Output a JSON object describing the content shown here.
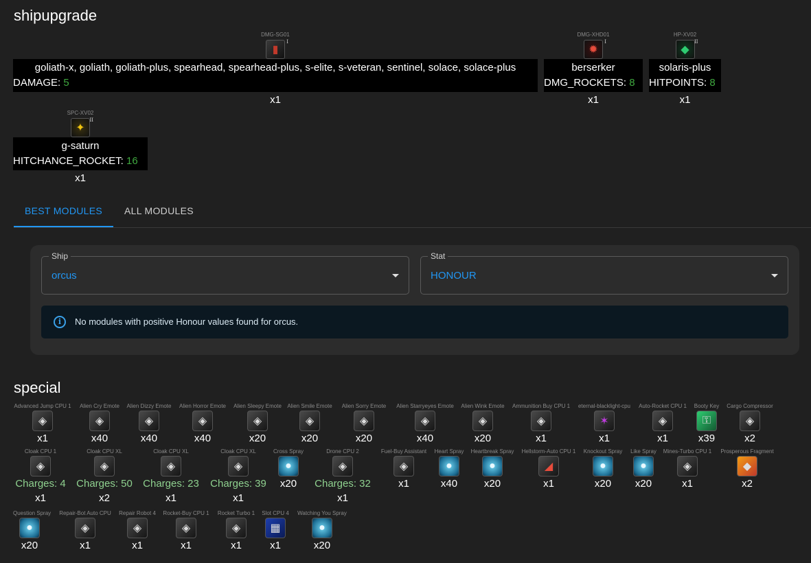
{
  "sections": {
    "shipupgrade_title": "shipupgrade",
    "special_title": "special"
  },
  "upgrades": [
    {
      "code": "DMG-SG01",
      "tier": "I",
      "ships": "goliath-x, goliath, goliath-plus, spearhead, spearhead-plus, s-elite, s-veteran, sentinel, solace, solace-plus",
      "stat": "DAMAGE:",
      "value": "5",
      "qty": "x1",
      "icon": "red-canister-icon"
    },
    {
      "code": "DMG-XHD01",
      "tier": "I",
      "ships": "berserker",
      "stat": "DMG_ROCKETS:",
      "value": "8",
      "qty": "x1",
      "icon": "red-claw-icon"
    },
    {
      "code": "HP-XV02",
      "tier": "II",
      "ships": "solaris-plus",
      "stat": "HITPOINTS:",
      "value": "8",
      "qty": "x1",
      "icon": "green-crystal-icon"
    },
    {
      "code": "SPC-XV02",
      "tier": "II",
      "ships": "g-saturn",
      "stat": "HITCHANCE_ROCKET:",
      "value": "16",
      "qty": "x1",
      "icon": "gold-armor-icon"
    }
  ],
  "tabs": {
    "best": "BEST MODULES",
    "all": "ALL MODULES"
  },
  "filters": {
    "ship_label": "Ship",
    "ship_value": "orcus",
    "stat_label": "Stat",
    "stat_value": "HONOUR",
    "info_message": "No modules with positive Honour values found for orcus."
  },
  "special_items": [
    {
      "name": "Advanced Jump CPU 1",
      "qty": "x1",
      "charges": "",
      "icon": "jump-cpu-icon"
    },
    {
      "name": "Alien Cry Emote",
      "qty": "x40",
      "charges": "",
      "icon": "alien-cry-icon"
    },
    {
      "name": "Alien Dizzy Emote",
      "qty": "x40",
      "charges": "",
      "icon": "alien-dizzy-icon"
    },
    {
      "name": "Alien Horror Emote",
      "qty": "x40",
      "charges": "",
      "icon": "alien-horror-icon"
    },
    {
      "name": "Alien Sleepy Emote",
      "qty": "x20",
      "charges": "",
      "icon": "alien-sleepy-icon"
    },
    {
      "name": "Alien Smile Emote",
      "qty": "x20",
      "charges": "",
      "icon": "alien-smile-icon"
    },
    {
      "name": "Alien Sorry Emote",
      "qty": "x20",
      "charges": "",
      "icon": "alien-sorry-icon"
    },
    {
      "name": "Alien Starryeyes Emote",
      "qty": "x40",
      "charges": "",
      "icon": "alien-starryeyes-icon"
    },
    {
      "name": "Alien Wink Emote",
      "qty": "x20",
      "charges": "",
      "icon": "alien-wink-icon"
    },
    {
      "name": "Ammunition Buy CPU 1",
      "qty": "x1",
      "charges": "",
      "icon": "ammo-buy-cpu-icon"
    },
    {
      "name": "eternal-blacklight-cpu",
      "qty": "x1",
      "charges": "",
      "icon": "blacklight-cpu-icon"
    },
    {
      "name": "Auto-Rocket CPU 1",
      "qty": "x1",
      "charges": "",
      "icon": "auto-rocket-cpu-icon"
    },
    {
      "name": "Booty Key",
      "qty": "x39",
      "charges": "",
      "icon": "booty-key-icon"
    },
    {
      "name": "Cargo Compressor",
      "qty": "x2",
      "charges": "",
      "icon": "cargo-compressor-icon"
    },
    {
      "name": "Cloak CPU 1",
      "qty": "x1",
      "charges": "Charges: 4",
      "icon": "cloak-cpu-icon"
    },
    {
      "name": "Cloak CPU XL",
      "qty": "x2",
      "charges": "Charges: 50",
      "icon": "cloak-cpu-xl-icon"
    },
    {
      "name": "Cloak CPU XL",
      "qty": "x1",
      "charges": "Charges: 23",
      "icon": "cloak-cpu-xl-icon"
    },
    {
      "name": "Cloak CPU XL",
      "qty": "x1",
      "charges": "Charges: 39",
      "icon": "cloak-cpu-xl-icon"
    },
    {
      "name": "Cross Spray",
      "qty": "x20",
      "charges": "",
      "icon": "cross-spray-icon"
    },
    {
      "name": "Drone CPU 2",
      "qty": "x1",
      "charges": "Charges: 32",
      "icon": "drone-cpu-icon"
    },
    {
      "name": "Fuel-Buy Assistant",
      "qty": "x1",
      "charges": "",
      "icon": "fuel-buy-icon"
    },
    {
      "name": "Heart Spray",
      "qty": "x40",
      "charges": "",
      "icon": "heart-spray-icon"
    },
    {
      "name": "Heartbreak Spray",
      "qty": "x20",
      "charges": "",
      "icon": "heartbreak-spray-icon"
    },
    {
      "name": "Hellstorm-Auto CPU 1",
      "qty": "x1",
      "charges": "",
      "icon": "hellstorm-cpu-icon"
    },
    {
      "name": "Knockout Spray",
      "qty": "x20",
      "charges": "",
      "icon": "knockout-spray-icon"
    },
    {
      "name": "Like Spray",
      "qty": "x20",
      "charges": "",
      "icon": "like-spray-icon"
    },
    {
      "name": "Mines-Turbo CPU 1",
      "qty": "x1",
      "charges": "",
      "icon": "mines-turbo-cpu-icon"
    },
    {
      "name": "Prosperous Fragment",
      "qty": "x2",
      "charges": "",
      "icon": "prosperous-fragment-icon"
    },
    {
      "name": "Question Spray",
      "qty": "x20",
      "charges": "",
      "icon": "question-spray-icon"
    },
    {
      "name": "Repair-Bot Auto CPU",
      "qty": "x1",
      "charges": "",
      "icon": "repair-bot-cpu-icon"
    },
    {
      "name": "Repair Robot 4",
      "qty": "x1",
      "charges": "",
      "icon": "repair-robot-icon"
    },
    {
      "name": "Rocket-Buy CPU 1",
      "qty": "x1",
      "charges": "",
      "icon": "rocket-buy-cpu-icon"
    },
    {
      "name": "Rocket Turbo 1",
      "qty": "x1",
      "charges": "",
      "icon": "rocket-turbo-icon"
    },
    {
      "name": "Slot CPU 4",
      "qty": "x1",
      "charges": "",
      "icon": "slot-cpu-icon"
    },
    {
      "name": "Watching You Spray",
      "qty": "x20",
      "charges": "",
      "icon": "watching-you-spray-icon"
    }
  ]
}
